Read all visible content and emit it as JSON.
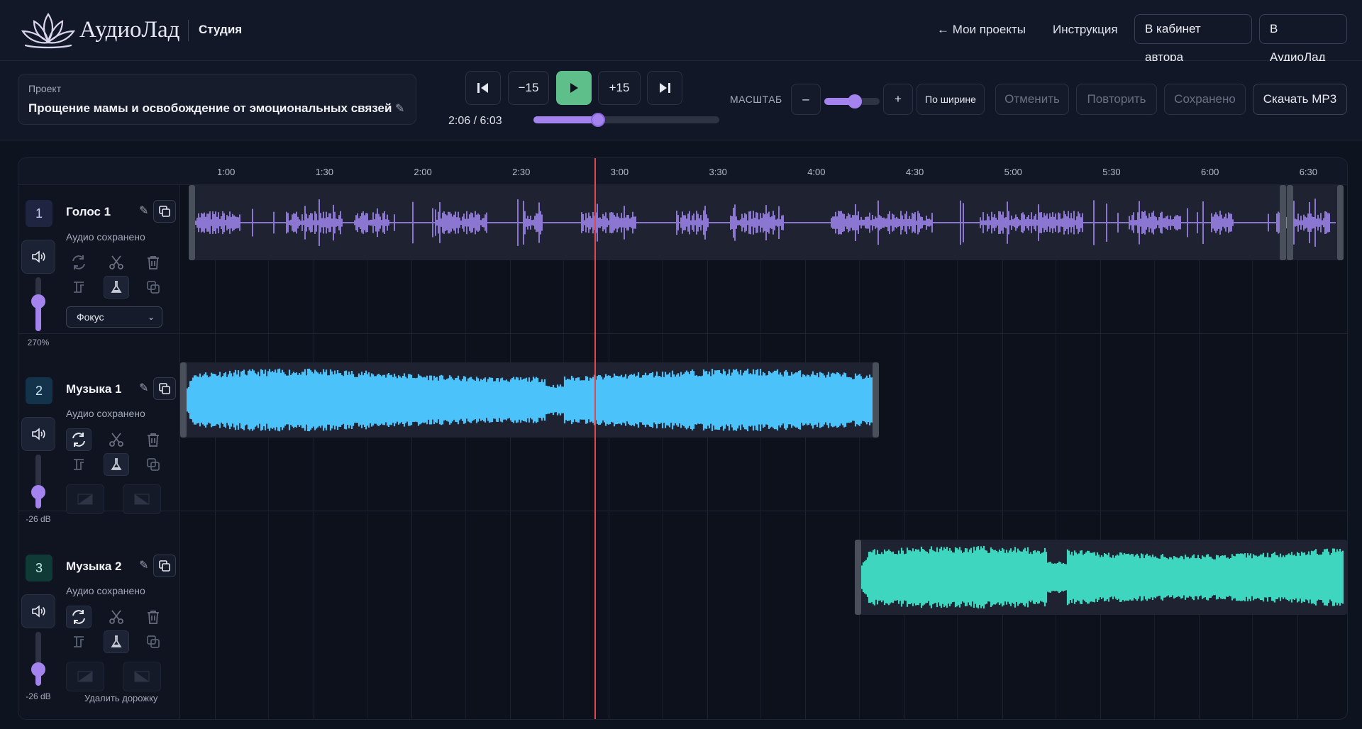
{
  "header": {
    "brand": "АудиоЛад",
    "section": "Студия",
    "nav_projects": "← Мои проекты",
    "nav_help": "Инструкция",
    "btn_cabinet": "В кабинет автора",
    "btn_audiolad": "В АудиоЛад"
  },
  "project": {
    "label": "Проект",
    "title": "Прощение мамы и освобождение от эмоциональных связей"
  },
  "transport": {
    "back15": "−15",
    "fwd15": "+15",
    "time": "2:06 / 6:03",
    "progress": 0.348
  },
  "zoom": {
    "label": "МАСШТАБ",
    "minus": "–",
    "plus": "+",
    "fit": "По ширине",
    "level": 0.55
  },
  "actions": {
    "undo": "Отменить",
    "redo": "Повторить",
    "saved": "Сохранено",
    "download": "Скачать MP3"
  },
  "ruler": {
    "ticks": [
      "1:00",
      "1:30",
      "2:00",
      "2:30",
      "3:00",
      "3:30",
      "4:00",
      "4:30",
      "5:00",
      "5:30",
      "6:00",
      "6:30"
    ]
  },
  "tracks": [
    {
      "num": "1",
      "name": "Голос 1",
      "status": "Аудио сохранено",
      "volume_label": "270%",
      "volume_level": 0.55,
      "color": "#a78bfa",
      "mode": "Фокус"
    },
    {
      "num": "2",
      "name": "Музыка 1",
      "status": "Аудио сохранено",
      "volume_label": "-26 dB",
      "volume_level": 0.3,
      "color": "#4cc2fb"
    },
    {
      "num": "3",
      "name": "Музыка 2",
      "status": "Аудио сохранено",
      "volume_label": "-26 dB",
      "volume_level": 0.3,
      "color": "#3fd6c0",
      "delete_label": "Удалить дорожку"
    }
  ],
  "icons": {
    "logo": "lotus-icon",
    "volume": "speaker-icon",
    "loop": "loop-icon",
    "cut": "scissors-icon",
    "delete": "trash-icon",
    "duplicate": "copy-icon"
  }
}
